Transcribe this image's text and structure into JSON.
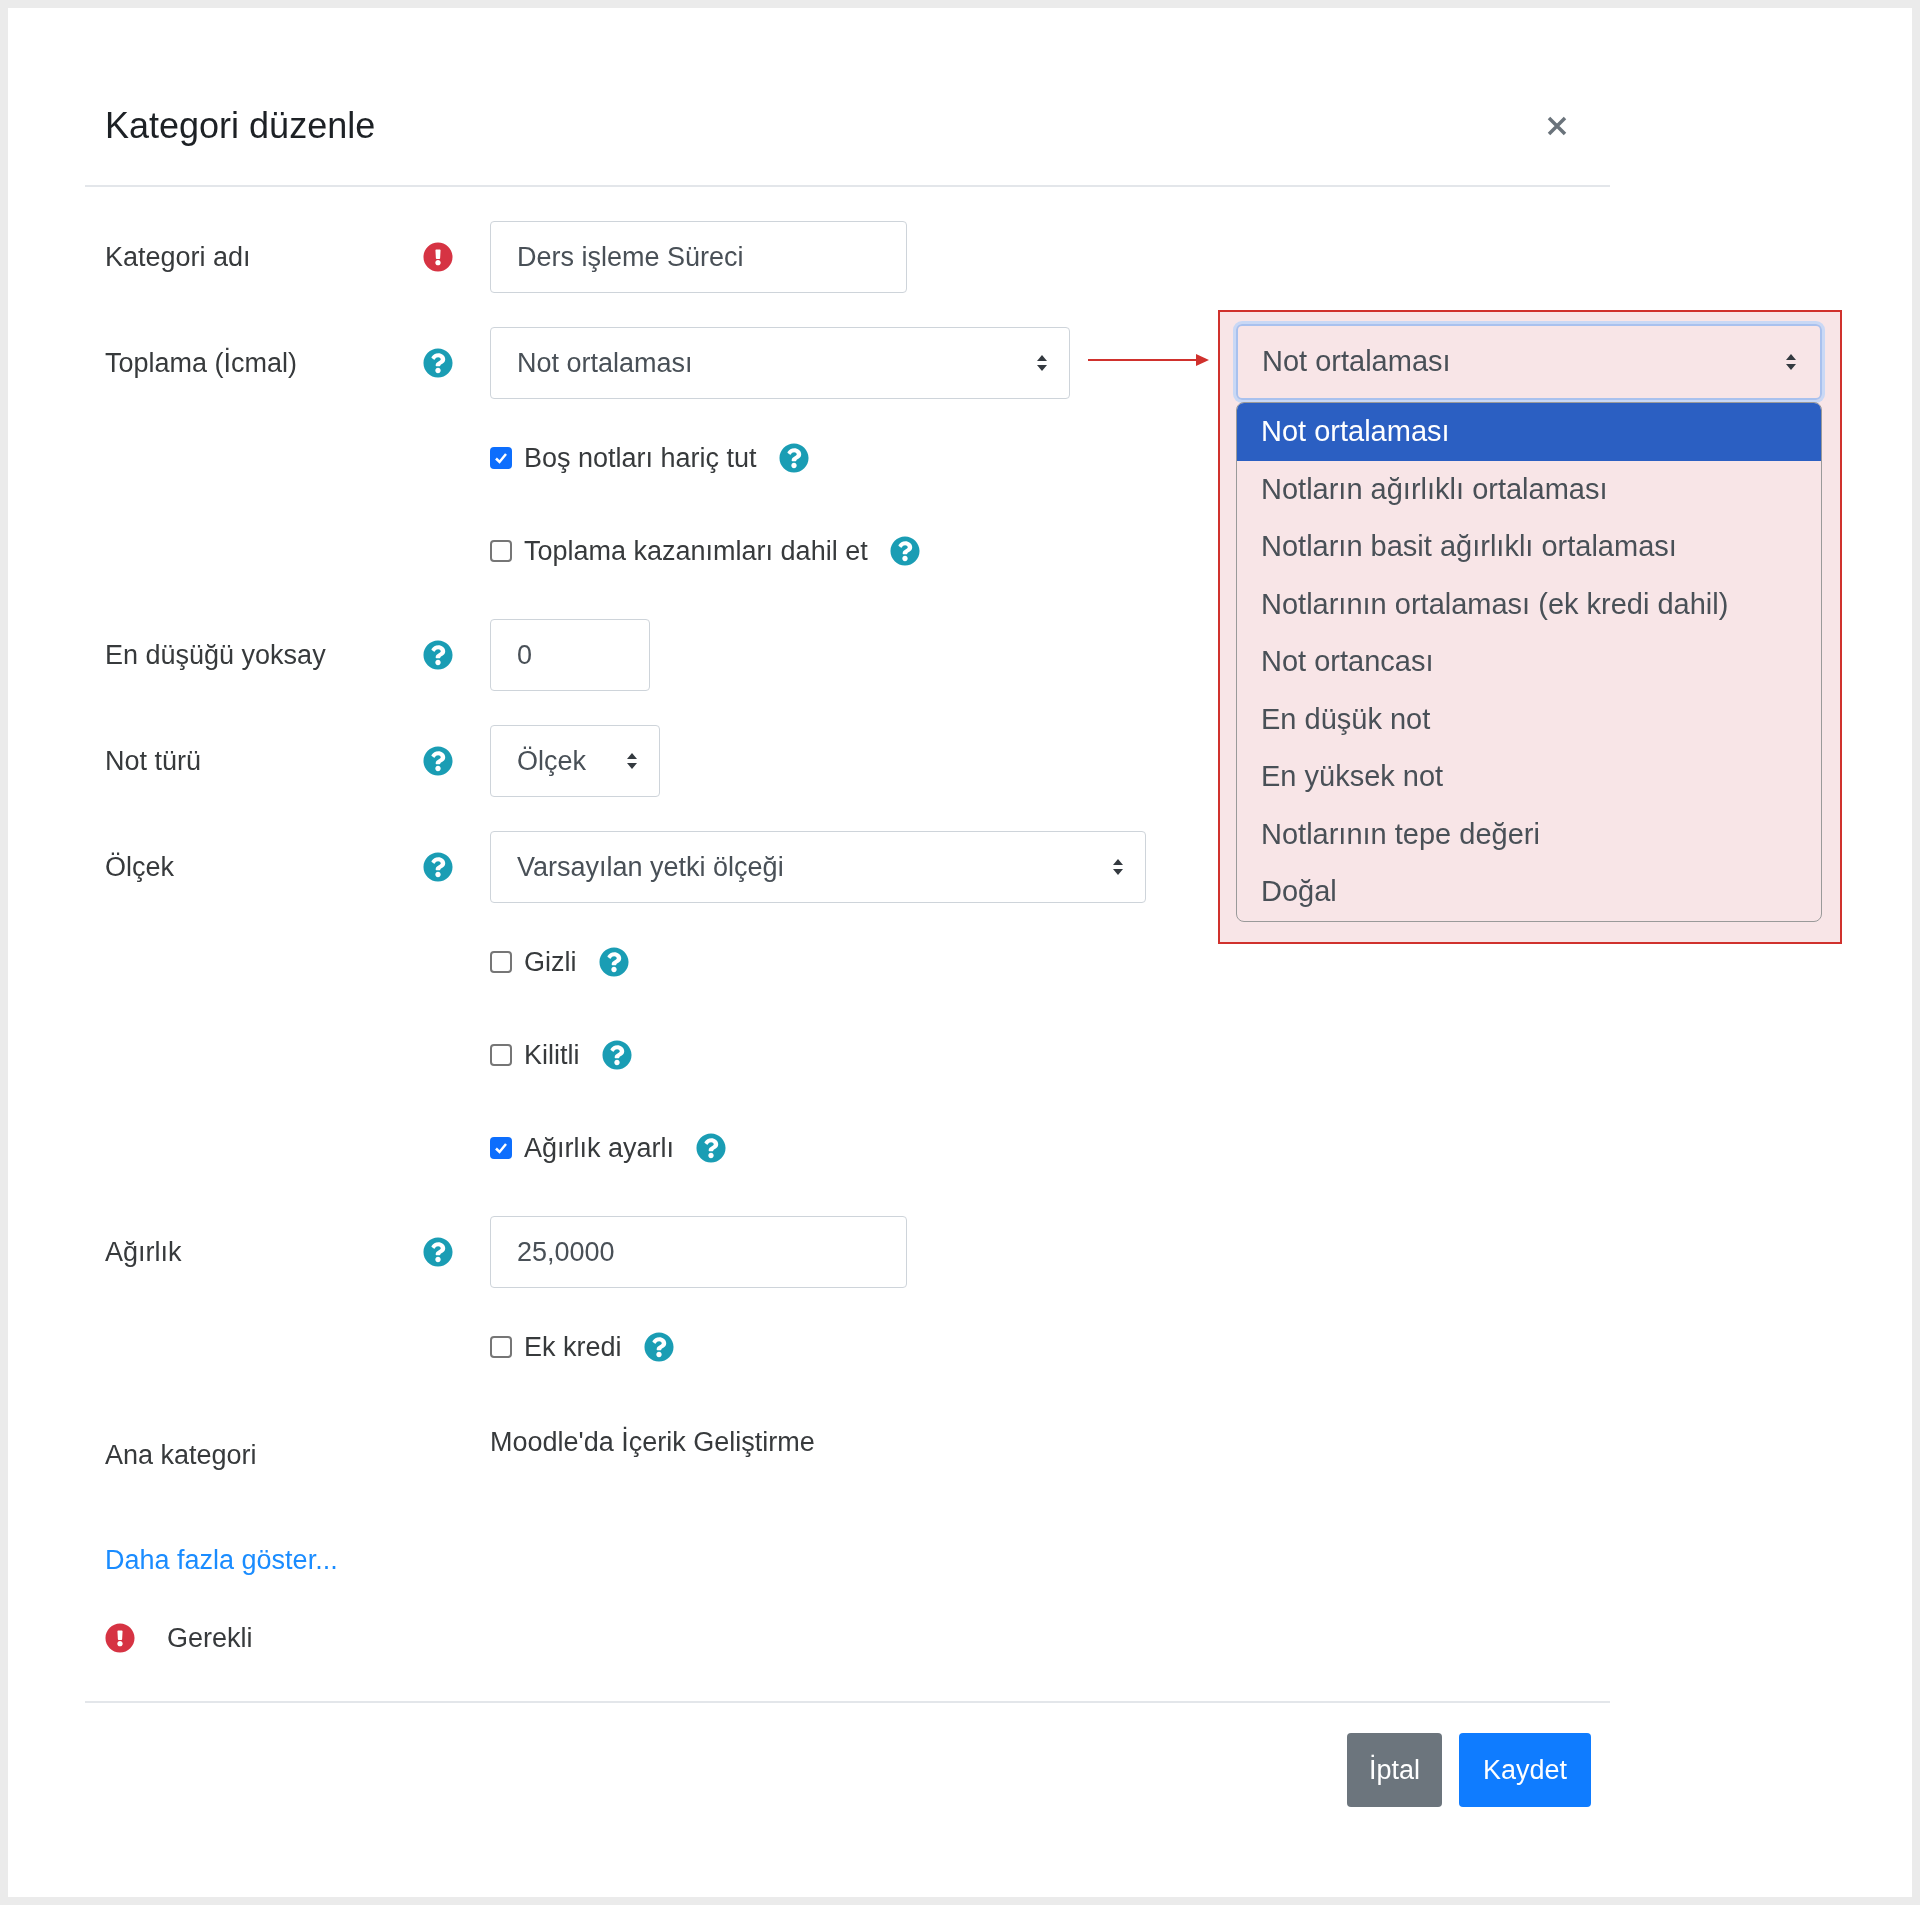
{
  "dialog": {
    "title": "Kategori düzenle"
  },
  "fields": [
    {
      "kind": "text",
      "label": "Kategori adı",
      "required": true,
      "value": "Ders işleme Süreci"
    },
    {
      "kind": "select",
      "label": "Toplama (İcmal)",
      "required": false,
      "value": "Not ortalaması"
    },
    {
      "kind": "checkbox",
      "label": "Boş notları hariç tut",
      "checked": true
    },
    {
      "kind": "checkbox",
      "label": "Toplama kazanımları dahil et",
      "checked": false
    },
    {
      "kind": "text",
      "label": "En düşüğü yoksay",
      "required": false,
      "value": "0"
    },
    {
      "kind": "select",
      "label": "Not türü",
      "required": false,
      "value": "Ölçek"
    },
    {
      "kind": "select",
      "label": "Ölçek",
      "required": false,
      "value": "Varsayılan yetki ölçeği"
    },
    {
      "kind": "checkbox",
      "label": "Gizli",
      "checked": false
    },
    {
      "kind": "checkbox",
      "label": "Kilitli",
      "checked": false
    },
    {
      "kind": "checkbox",
      "label": "Ağırlık ayarlı",
      "checked": true
    },
    {
      "kind": "text",
      "label": "Ağırlık",
      "required": false,
      "value": "25,0000"
    },
    {
      "kind": "checkbox",
      "label": "Ek kredi",
      "checked": false
    },
    {
      "kind": "static",
      "label": "Ana kategori",
      "value": "Moodle'da İçerik Geliştirme"
    }
  ],
  "show_more_link": "Daha fazla göster...",
  "required_note": "Gerekli",
  "buttons": [
    {
      "label": "İptal",
      "kind": "secondary"
    },
    {
      "label": "Kaydet",
      "kind": "primary"
    }
  ],
  "callout": {
    "select_value": "Not ortalaması",
    "options": [
      {
        "label": "Not ortalaması",
        "selected": true
      },
      {
        "label": "Notların ağırlıklı ortalaması",
        "selected": false
      },
      {
        "label": "Notların basit ağırlıklı ortalaması",
        "selected": false
      },
      {
        "label": "Notlarının ortalaması (ek kredi dahil)",
        "selected": false
      },
      {
        "label": "Not ortancası",
        "selected": false
      },
      {
        "label": "En düşük not",
        "selected": false
      },
      {
        "label": "En yüksek not",
        "selected": false
      },
      {
        "label": "Notlarının tepe değeri",
        "selected": false
      },
      {
        "label": "Doğal",
        "selected": false
      }
    ]
  }
}
